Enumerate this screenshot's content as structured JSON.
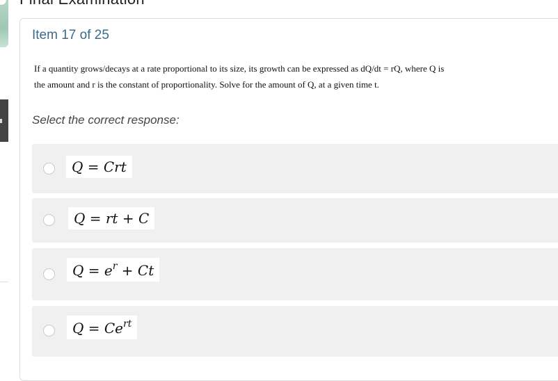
{
  "exam": {
    "heading": "Final Examination"
  },
  "item": {
    "counter": "Item 17 of 25"
  },
  "question": {
    "line1": "If a quantity grows/decays at a rate proportional to its size, its growth can be expressed as dQ/dt = rQ, where Q is",
    "line2": "the amount and r is the constant of proportionality. Solve for the amount of Q, at a given time t."
  },
  "prompt": "Select the correct response:",
  "options": [
    {
      "formula": "Q = Crt",
      "selected": false
    },
    {
      "formula": "Q = rt + C",
      "selected": false
    },
    {
      "formula_base": "Q = e",
      "formula_sup": "r",
      "formula_tail": " + Ct",
      "selected": false
    },
    {
      "formula_base": "Q = Ce",
      "formula_sup": "rt",
      "selected": false
    }
  ]
}
